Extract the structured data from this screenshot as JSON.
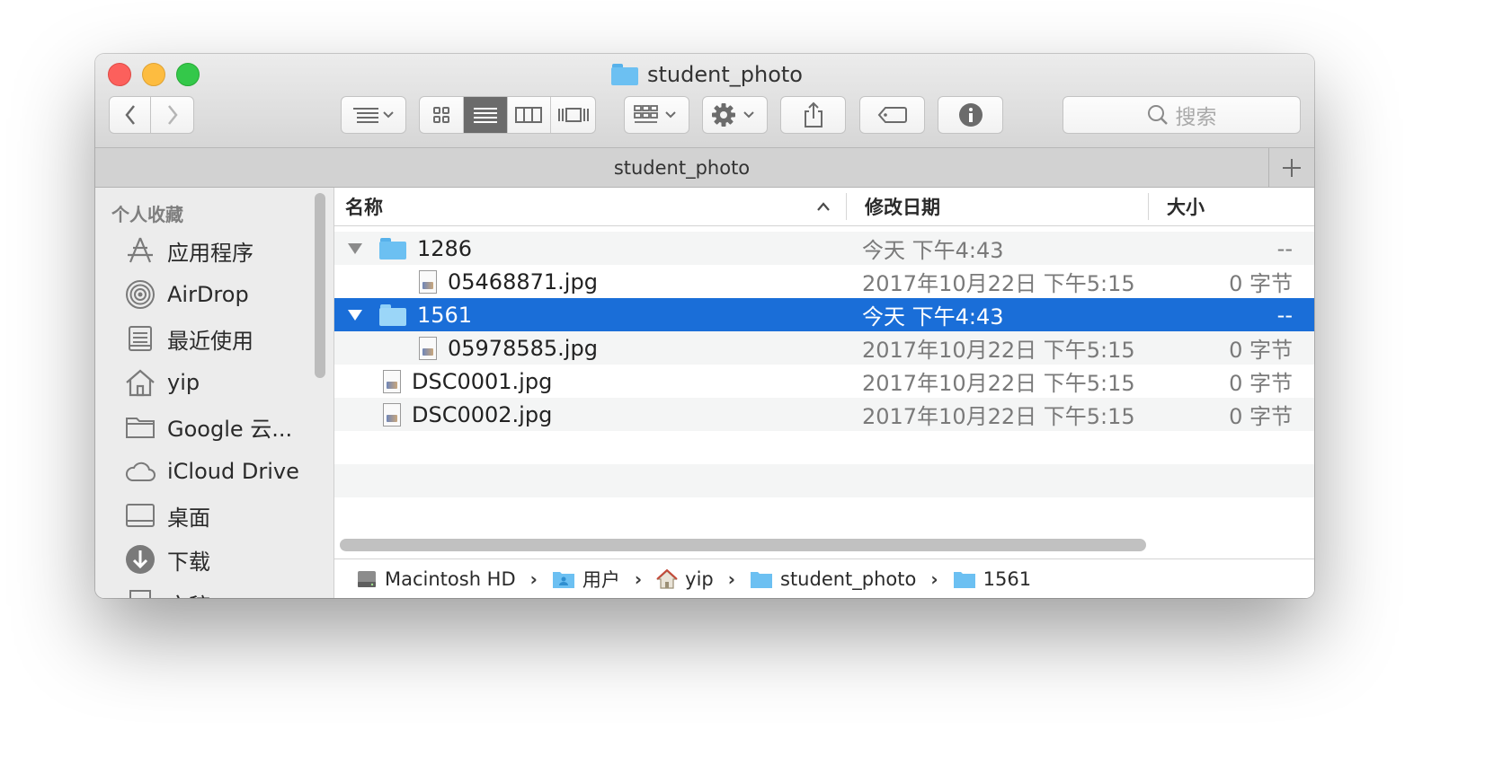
{
  "window": {
    "title": "student_photo",
    "tab_title": "student_photo"
  },
  "toolbar": {
    "back": "back",
    "forward": "forward",
    "search_placeholder": "搜索"
  },
  "sidebar": {
    "heading": "个人收藏",
    "items": [
      {
        "label": "应用程序",
        "icon": "applications-icon"
      },
      {
        "label": "AirDrop",
        "icon": "airdrop-icon"
      },
      {
        "label": "最近使用",
        "icon": "recents-icon"
      },
      {
        "label": "yip",
        "icon": "home-icon"
      },
      {
        "label": "Google 云...",
        "icon": "folder-icon"
      },
      {
        "label": "iCloud Drive",
        "icon": "cloud-icon"
      },
      {
        "label": "桌面",
        "icon": "desktop-icon"
      },
      {
        "label": "下载",
        "icon": "download-icon"
      },
      {
        "label": "文稿",
        "icon": "documents-icon"
      }
    ]
  },
  "columns": {
    "name": "名称",
    "date": "修改日期",
    "size": "大小"
  },
  "rows": [
    {
      "name": "1286",
      "date": "今天 下午4:43",
      "size": "--"
    },
    {
      "name": "05468871.jpg",
      "date": "2017年10月22日 下午5:15",
      "size": "0 字节"
    },
    {
      "name": "1561",
      "date": "今天 下午4:43",
      "size": "--"
    },
    {
      "name": "05978585.jpg",
      "date": "2017年10月22日 下午5:15",
      "size": "0 字节"
    },
    {
      "name": "DSC0001.jpg",
      "date": "2017年10月22日 下午5:15",
      "size": "0 字节"
    },
    {
      "name": "DSC0002.jpg",
      "date": "2017年10月22日 下午5:15",
      "size": "0 字节"
    }
  ],
  "pathbar": [
    "Macintosh HD",
    "用户",
    "yip",
    "student_photo",
    "1561"
  ],
  "colors": {
    "selection": "#1a6ed8",
    "folder": "#6cc0f2"
  }
}
